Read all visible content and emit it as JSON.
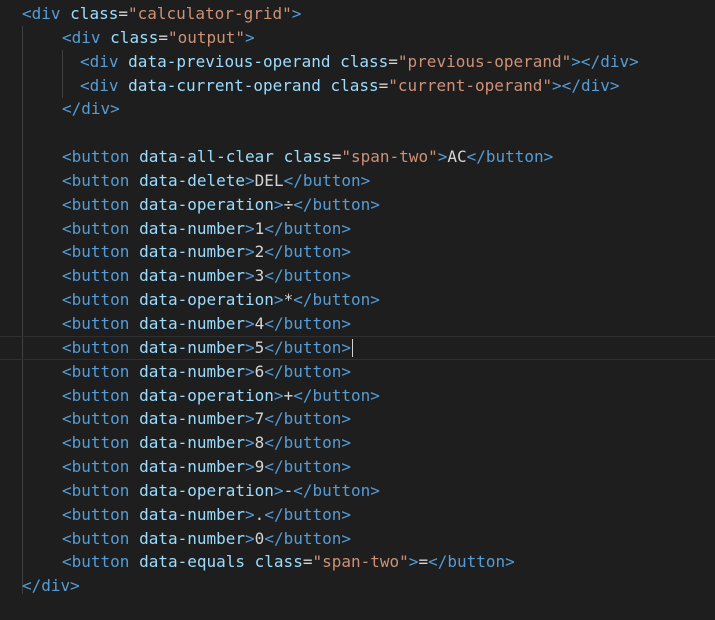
{
  "editor": {
    "language": "html",
    "colors": {
      "background": "#1e1e1e",
      "tag": "#569cd6",
      "attribute": "#9cdcfe",
      "string": "#ce9178",
      "text": "#d4d4d4"
    },
    "lines": [
      {
        "indent": 0,
        "tokens": [
          [
            "tag",
            "<div "
          ],
          [
            "attr",
            "class"
          ],
          [
            "txt",
            "="
          ],
          [
            "str",
            "\"calculator-grid\""
          ],
          [
            "tag",
            ">"
          ]
        ]
      },
      {
        "indent": 1,
        "tokens": [
          [
            "tag",
            "<div "
          ],
          [
            "attr",
            "class"
          ],
          [
            "txt",
            "="
          ],
          [
            "str",
            "\"output\""
          ],
          [
            "tag",
            ">"
          ]
        ]
      },
      {
        "indent": 2,
        "tokens": [
          [
            "tag",
            "<div "
          ],
          [
            "attr",
            "data-previous-operand "
          ],
          [
            "attr",
            "class"
          ],
          [
            "txt",
            "="
          ],
          [
            "str",
            "\"previous-operand\""
          ],
          [
            "tag",
            "></div>"
          ]
        ]
      },
      {
        "indent": 2,
        "tokens": [
          [
            "tag",
            "<div "
          ],
          [
            "attr",
            "data-current-operand "
          ],
          [
            "attr",
            "class"
          ],
          [
            "txt",
            "="
          ],
          [
            "str",
            "\"current-operand\""
          ],
          [
            "tag",
            "></div>"
          ]
        ]
      },
      {
        "indent": 1,
        "tokens": [
          [
            "tag",
            "</div>"
          ]
        ]
      },
      {
        "indent": 0,
        "tokens": []
      },
      {
        "indent": 1,
        "tokens": [
          [
            "tag",
            "<button "
          ],
          [
            "attr",
            "data-all-clear "
          ],
          [
            "attr",
            "class"
          ],
          [
            "txt",
            "="
          ],
          [
            "str",
            "\"span-two\""
          ],
          [
            "tag",
            ">"
          ],
          [
            "txt",
            "AC"
          ],
          [
            "tag",
            "</button>"
          ]
        ]
      },
      {
        "indent": 1,
        "tokens": [
          [
            "tag",
            "<button "
          ],
          [
            "attr",
            "data-delete"
          ],
          [
            "tag",
            ">"
          ],
          [
            "txt",
            "DEL"
          ],
          [
            "tag",
            "</button>"
          ]
        ]
      },
      {
        "indent": 1,
        "tokens": [
          [
            "tag",
            "<button "
          ],
          [
            "attr",
            "data-operation"
          ],
          [
            "tag",
            ">"
          ],
          [
            "txt",
            "÷"
          ],
          [
            "tag",
            "</button>"
          ]
        ]
      },
      {
        "indent": 1,
        "tokens": [
          [
            "tag",
            "<button "
          ],
          [
            "attr",
            "data-number"
          ],
          [
            "tag",
            ">"
          ],
          [
            "txt",
            "1"
          ],
          [
            "tag",
            "</button>"
          ]
        ]
      },
      {
        "indent": 1,
        "tokens": [
          [
            "tag",
            "<button "
          ],
          [
            "attr",
            "data-number"
          ],
          [
            "tag",
            ">"
          ],
          [
            "txt",
            "2"
          ],
          [
            "tag",
            "</button>"
          ]
        ]
      },
      {
        "indent": 1,
        "tokens": [
          [
            "tag",
            "<button "
          ],
          [
            "attr",
            "data-number"
          ],
          [
            "tag",
            ">"
          ],
          [
            "txt",
            "3"
          ],
          [
            "tag",
            "</button>"
          ]
        ]
      },
      {
        "indent": 1,
        "tokens": [
          [
            "tag",
            "<button "
          ],
          [
            "attr",
            "data-operation"
          ],
          [
            "tag",
            ">"
          ],
          [
            "txt",
            "*"
          ],
          [
            "tag",
            "</button>"
          ]
        ]
      },
      {
        "indent": 1,
        "tokens": [
          [
            "tag",
            "<button "
          ],
          [
            "attr",
            "data-number"
          ],
          [
            "tag",
            ">"
          ],
          [
            "txt",
            "4"
          ],
          [
            "tag",
            "</button>"
          ]
        ]
      },
      {
        "indent": 1,
        "current": true,
        "tokens": [
          [
            "tag",
            "<button "
          ],
          [
            "attr",
            "data-number"
          ],
          [
            "tag",
            ">"
          ],
          [
            "txt",
            "5"
          ],
          [
            "tag",
            "</button>"
          ]
        ]
      },
      {
        "indent": 1,
        "tokens": [
          [
            "tag",
            "<button "
          ],
          [
            "attr",
            "data-number"
          ],
          [
            "tag",
            ">"
          ],
          [
            "txt",
            "6"
          ],
          [
            "tag",
            "</button>"
          ]
        ]
      },
      {
        "indent": 1,
        "tokens": [
          [
            "tag",
            "<button "
          ],
          [
            "attr",
            "data-operation"
          ],
          [
            "tag",
            ">"
          ],
          [
            "txt",
            "+"
          ],
          [
            "tag",
            "</button>"
          ]
        ]
      },
      {
        "indent": 1,
        "tokens": [
          [
            "tag",
            "<button "
          ],
          [
            "attr",
            "data-number"
          ],
          [
            "tag",
            ">"
          ],
          [
            "txt",
            "7"
          ],
          [
            "tag",
            "</button>"
          ]
        ]
      },
      {
        "indent": 1,
        "tokens": [
          [
            "tag",
            "<button "
          ],
          [
            "attr",
            "data-number"
          ],
          [
            "tag",
            ">"
          ],
          [
            "txt",
            "8"
          ],
          [
            "tag",
            "</button>"
          ]
        ]
      },
      {
        "indent": 1,
        "tokens": [
          [
            "tag",
            "<button "
          ],
          [
            "attr",
            "data-number"
          ],
          [
            "tag",
            ">"
          ],
          [
            "txt",
            "9"
          ],
          [
            "tag",
            "</button>"
          ]
        ]
      },
      {
        "indent": 1,
        "tokens": [
          [
            "tag",
            "<button "
          ],
          [
            "attr",
            "data-operation"
          ],
          [
            "tag",
            ">"
          ],
          [
            "txt",
            "-"
          ],
          [
            "tag",
            "</button>"
          ]
        ]
      },
      {
        "indent": 1,
        "tokens": [
          [
            "tag",
            "<button "
          ],
          [
            "attr",
            "data-number"
          ],
          [
            "tag",
            ">"
          ],
          [
            "txt",
            "."
          ],
          [
            "tag",
            "</button>"
          ]
        ]
      },
      {
        "indent": 1,
        "tokens": [
          [
            "tag",
            "<button "
          ],
          [
            "attr",
            "data-number"
          ],
          [
            "tag",
            ">"
          ],
          [
            "txt",
            "0"
          ],
          [
            "tag",
            "</button>"
          ]
        ]
      },
      {
        "indent": 1,
        "tokens": [
          [
            "tag",
            "<button "
          ],
          [
            "attr",
            "data-equals "
          ],
          [
            "attr",
            "class"
          ],
          [
            "txt",
            "="
          ],
          [
            "str",
            "\"span-two\""
          ],
          [
            "tag",
            ">"
          ],
          [
            "txt",
            "="
          ],
          [
            "tag",
            "</button>"
          ]
        ]
      },
      {
        "indent": 0,
        "tokens": [
          [
            "tag",
            "</div>"
          ]
        ]
      }
    ]
  }
}
